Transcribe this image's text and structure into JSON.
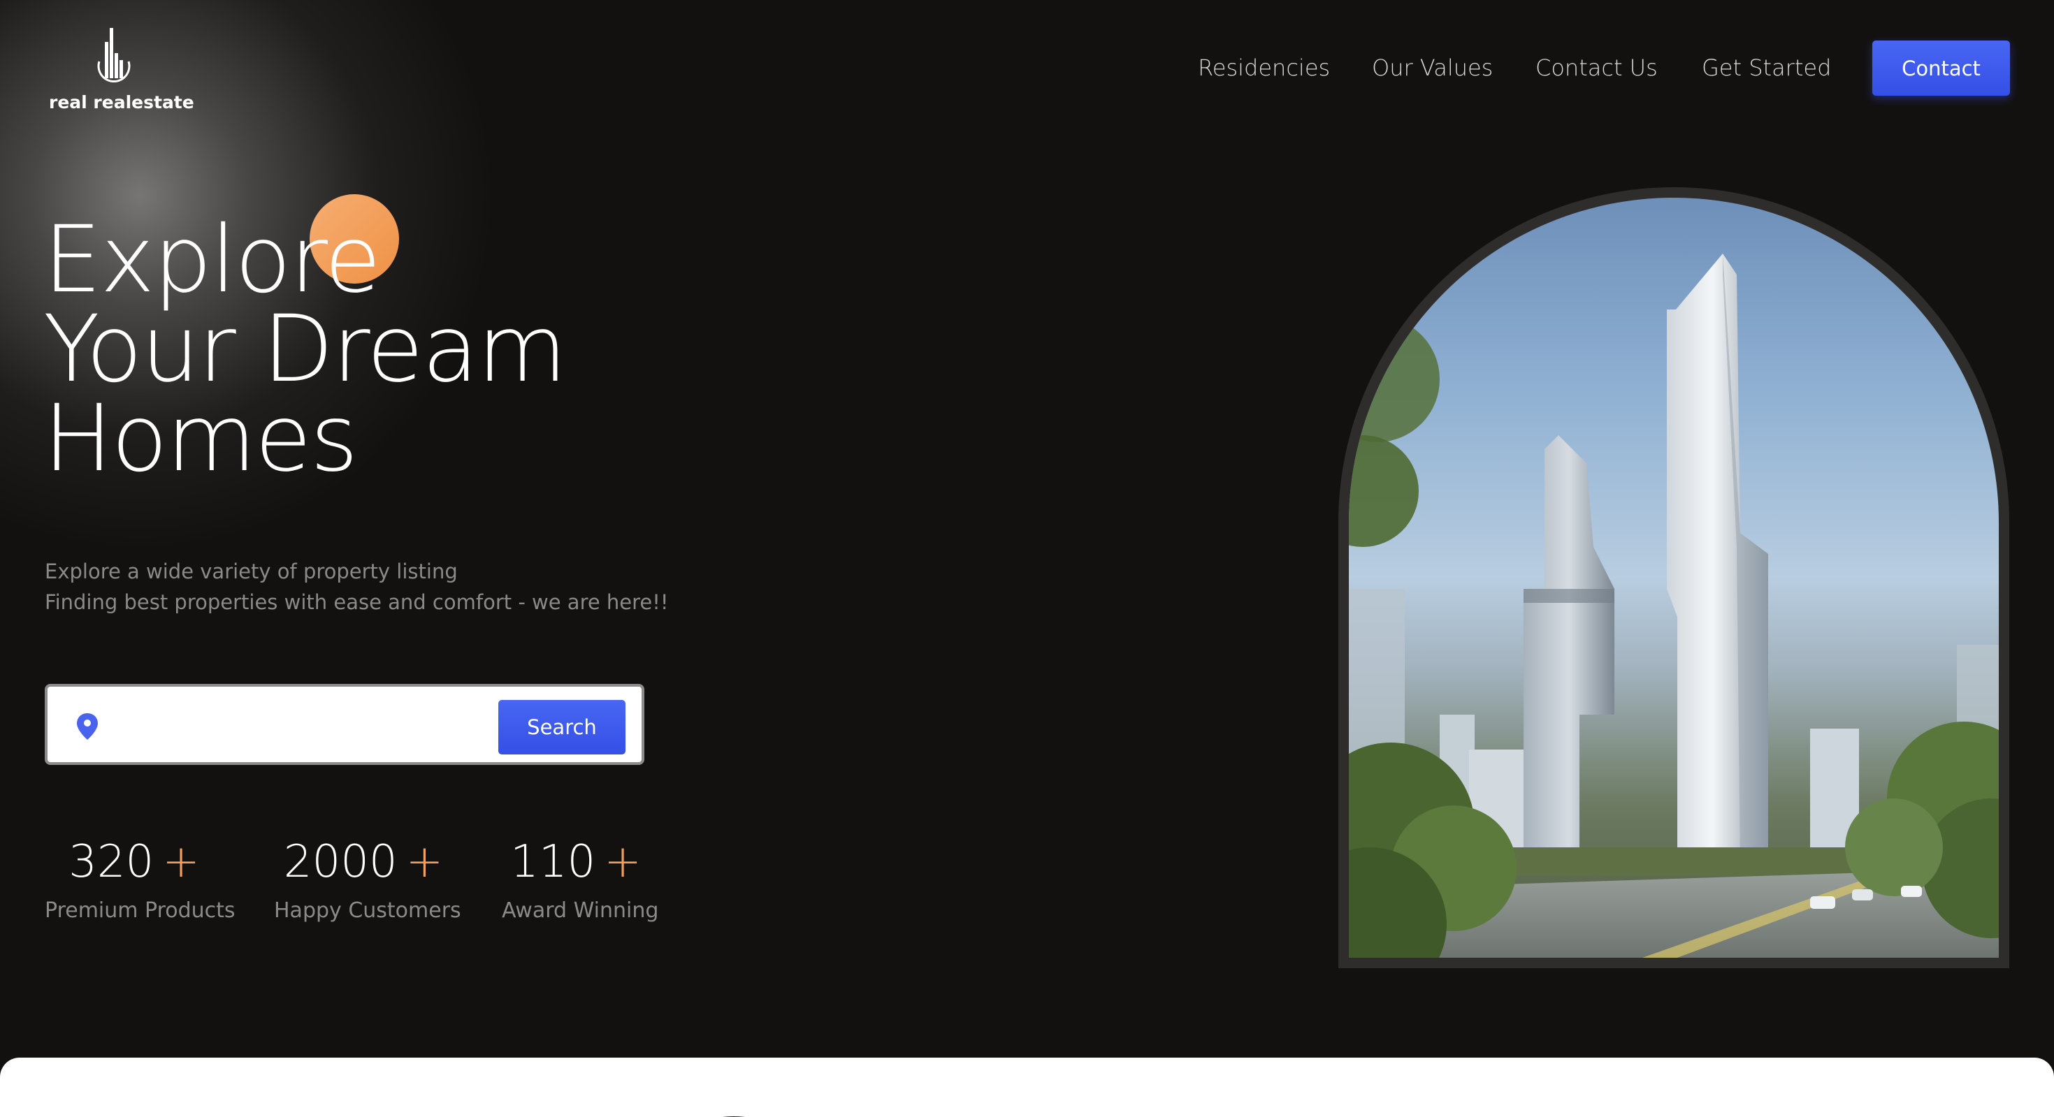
{
  "brand": {
    "name": "real realestate",
    "logo_icon": "building-bars-icon"
  },
  "nav": {
    "links": [
      "Residencies",
      "Our Values",
      "Contact Us",
      "Get Started"
    ],
    "contact_label": "Contact"
  },
  "hero": {
    "title_lines": [
      "Explore",
      "Your Dream",
      "Homes"
    ],
    "subtitle_lines": [
      "Explore a wide variety of property listing",
      "Finding best properties with ease and comfort - we are here!!"
    ],
    "search": {
      "icon": "location-pin-icon",
      "value": "",
      "button_label": "Search"
    }
  },
  "stats": [
    {
      "value": "320",
      "suffix": "+",
      "label": "Premium Products"
    },
    {
      "value": "2000",
      "suffix": "+",
      "label": "Happy Customers"
    },
    {
      "value": "110",
      "suffix": "+",
      "label": "Award Winning"
    }
  ],
  "colors": {
    "background": "#131110",
    "accent_blue": "#4066ff",
    "accent_orange": "#f5a05a",
    "muted_text": "#8b8a89"
  }
}
